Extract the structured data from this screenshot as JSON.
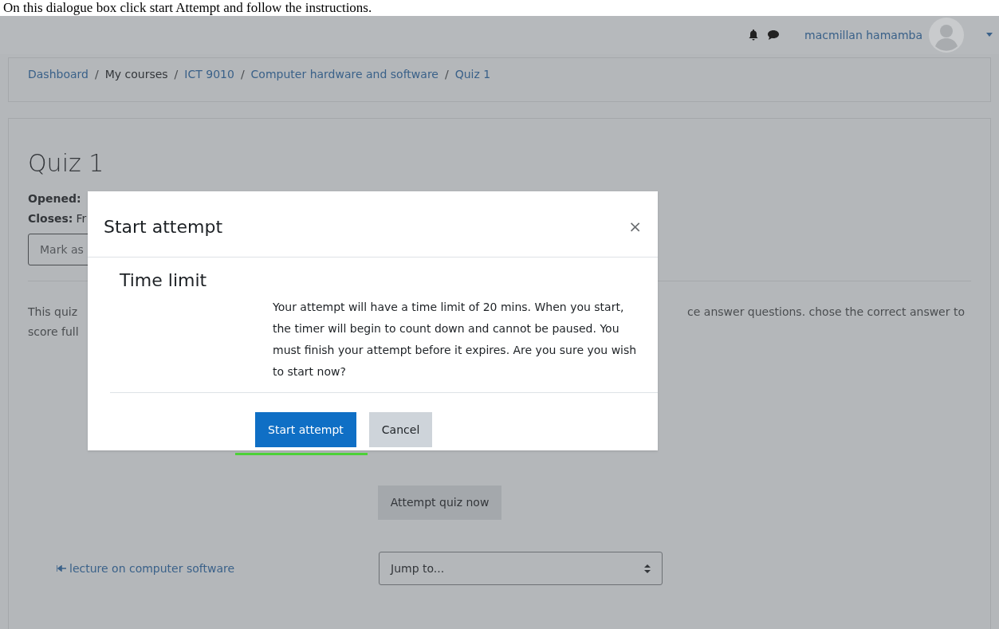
{
  "caption": "On this dialogue box click start Attempt and follow the instructions.",
  "header": {
    "user_name": "macmillan hamamba"
  },
  "breadcrumb": [
    {
      "label": "Dashboard",
      "kind": "link"
    },
    {
      "label": "/",
      "kind": "separator"
    },
    {
      "label": "My courses",
      "kind": "text"
    },
    {
      "label": "/",
      "kind": "separator"
    },
    {
      "label": "ICT 9010",
      "kind": "link"
    },
    {
      "label": "/",
      "kind": "separator"
    },
    {
      "label": "Computer hardware and software",
      "kind": "link"
    },
    {
      "label": "/",
      "kind": "separator"
    },
    {
      "label": "Quiz 1",
      "kind": "link"
    }
  ],
  "page": {
    "title": "Quiz 1",
    "opened_label": "Opened:",
    "closes_label": "Closes:",
    "closes_value": "Fr",
    "mark_button": "Mark as",
    "intro_left": [
      "This quiz",
      "score full"
    ],
    "intro_right": "ce answer questions. chose the correct answer to",
    "attempt_button": "Attempt quiz now",
    "prev_link": "lecture on computer software",
    "jump_select": {
      "value": "Jump to..."
    }
  },
  "dialog": {
    "title": "Start attempt",
    "close": "×",
    "section_title": "Time limit",
    "message": "Your attempt will have a time limit of 20 mins. When you start, the timer will begin to count down and cannot be paused. You must finish your attempt before it expires. Are you sure you wish to start now?",
    "buttons": [
      {
        "label": "Start attempt",
        "kind": "primary",
        "underlined": true
      },
      {
        "label": "Cancel",
        "kind": "secondary",
        "underlined": false
      }
    ]
  }
}
